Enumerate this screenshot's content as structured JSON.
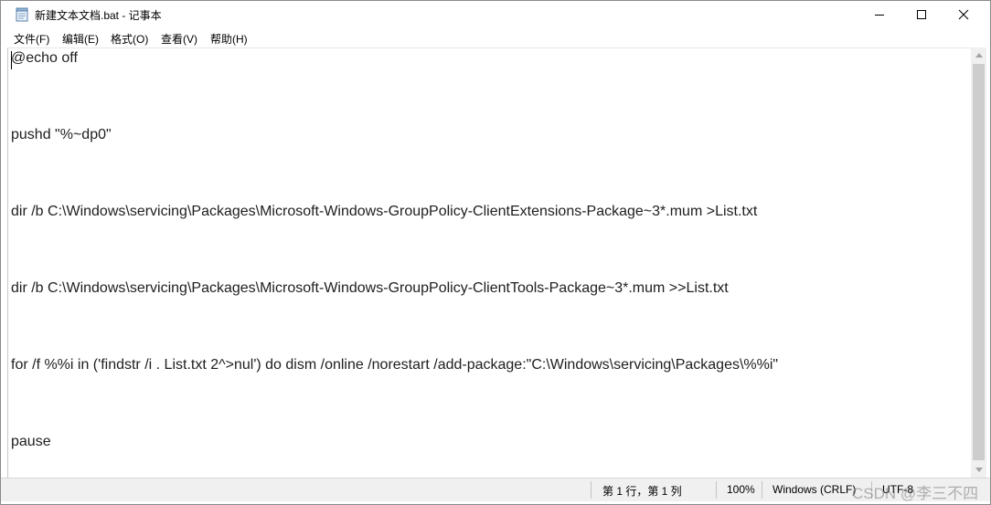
{
  "window": {
    "title": "新建文本文档.bat - 记事本",
    "icon": "notepad-icon"
  },
  "caption_buttons": {
    "minimize": "minimize-icon",
    "maximize": "maximize-icon",
    "close": "close-icon"
  },
  "menu": [
    {
      "label": "文件(F)"
    },
    {
      "label": "编辑(E)"
    },
    {
      "label": "格式(O)"
    },
    {
      "label": "查看(V)"
    },
    {
      "label": "帮助(H)"
    }
  ],
  "editor": {
    "lines": [
      "@echo off",
      "pushd \"%~dp0\"",
      "dir /b C:\\Windows\\servicing\\Packages\\Microsoft-Windows-GroupPolicy-ClientExtensions-Package~3*.mum >List.txt",
      "dir /b C:\\Windows\\servicing\\Packages\\Microsoft-Windows-GroupPolicy-ClientTools-Package~3*.mum >>List.txt",
      "for /f %%i in ('findstr /i . List.txt 2^>nul') do dism /online /norestart /add-package:\"C:\\Windows\\servicing\\Packages\\%%i\"",
      "pause"
    ]
  },
  "statusbar": {
    "position": "第 1 行，第 1 列",
    "zoom": "100%",
    "line_ending": "Windows (CRLF)",
    "encoding": "UTF-8"
  },
  "watermark": "CSDN @李三不四",
  "colors": {
    "background": "#ffffff",
    "statusbar_bg": "#f0f0f0",
    "text": "#1e1e1e"
  }
}
